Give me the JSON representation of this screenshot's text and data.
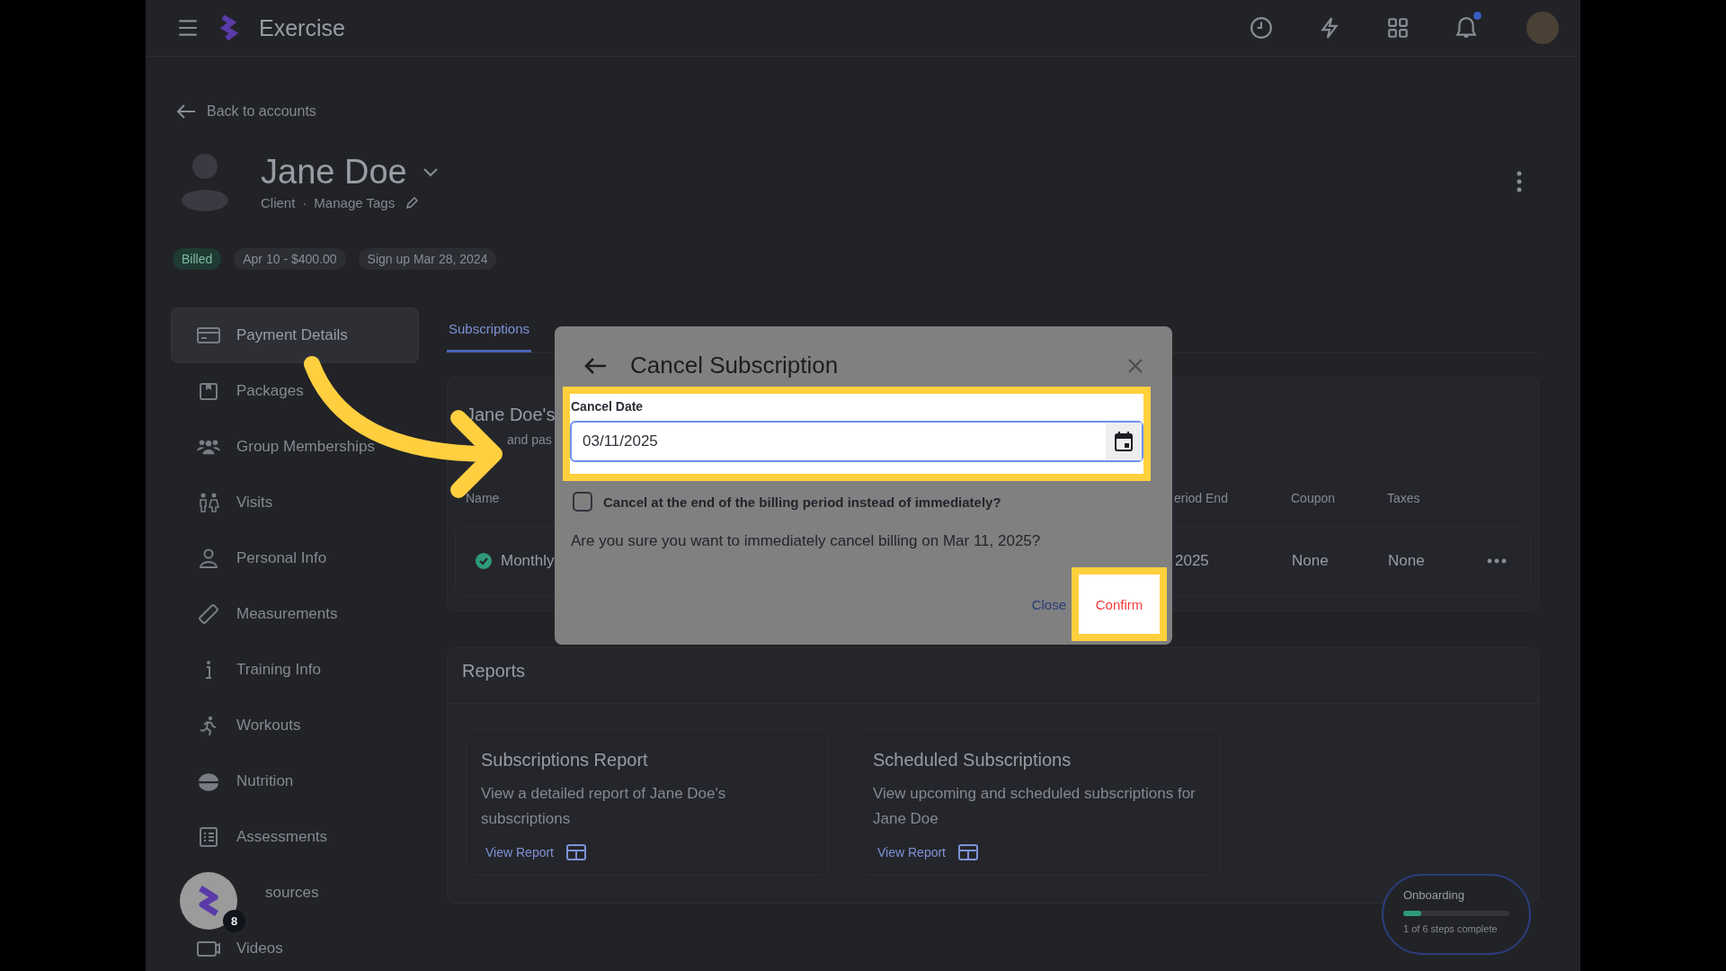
{
  "topbar": {
    "app_name": "Exercise",
    "notification_dot": true
  },
  "back_link": "Back to accounts",
  "profile": {
    "name": "Jane Doe",
    "role": "Client",
    "separator": "·",
    "tags_link": "Manage Tags"
  },
  "chips": [
    {
      "label": "Billed",
      "kind": "status"
    },
    {
      "label": "Apr 10 - $400.00",
      "kind": "info"
    },
    {
      "label": "Sign up Mar 28, 2024",
      "kind": "info"
    }
  ],
  "sidebar": {
    "items": [
      {
        "label": "Payment Details",
        "selected": true
      },
      {
        "label": "Packages",
        "selected": false
      },
      {
        "label": "Group Memberships",
        "selected": false
      },
      {
        "label": "Visits",
        "selected": false
      },
      {
        "label": "Personal Info",
        "selected": false
      },
      {
        "label": "Measurements",
        "selected": false
      },
      {
        "label": "Training Info",
        "selected": false
      },
      {
        "label": "Workouts",
        "selected": false
      },
      {
        "label": "Nutrition",
        "selected": false
      },
      {
        "label": "Assessments",
        "selected": false
      },
      {
        "label": "sources",
        "selected": false
      },
      {
        "label": "Videos",
        "selected": false
      }
    ]
  },
  "tabs": [
    {
      "label": "Subscriptions",
      "selected": true
    }
  ],
  "subscriptions": {
    "title": "Jane Doe's",
    "subtitle": "and pas",
    "columns": [
      "Name",
      "eriod End",
      "Coupon",
      "Taxes"
    ],
    "rows": [
      {
        "name": "Monthly",
        "period_end": "2025",
        "coupon": "None",
        "taxes": "None",
        "active": true
      }
    ]
  },
  "reports": {
    "title": "Reports",
    "cards": [
      {
        "title": "Subscriptions Report",
        "description": "View a detailed report of Jane Doe's subscriptions",
        "link": "View Report"
      },
      {
        "title": "Scheduled Subscriptions",
        "description": "View upcoming and scheduled subscriptions for Jane Doe",
        "link": "View Report"
      }
    ]
  },
  "modal": {
    "title": "Cancel Subscription",
    "field_label": "Cancel Date",
    "field_value": "03/11/2025",
    "checkbox": {
      "label": "Cancel at the end of the billing period instead of immediately?",
      "checked": false
    },
    "question": "Are you sure you want to immediately cancel billing on Mar 11, 2025?",
    "buttons": [
      {
        "label": "Close",
        "kind": "text"
      },
      {
        "label": "Confirm",
        "kind": "primary"
      }
    ]
  },
  "help_widget": {
    "badge": "8"
  },
  "onboarding": {
    "title": "Onboarding",
    "level": 0.17,
    "caption": "1 of 6 steps complete"
  }
}
